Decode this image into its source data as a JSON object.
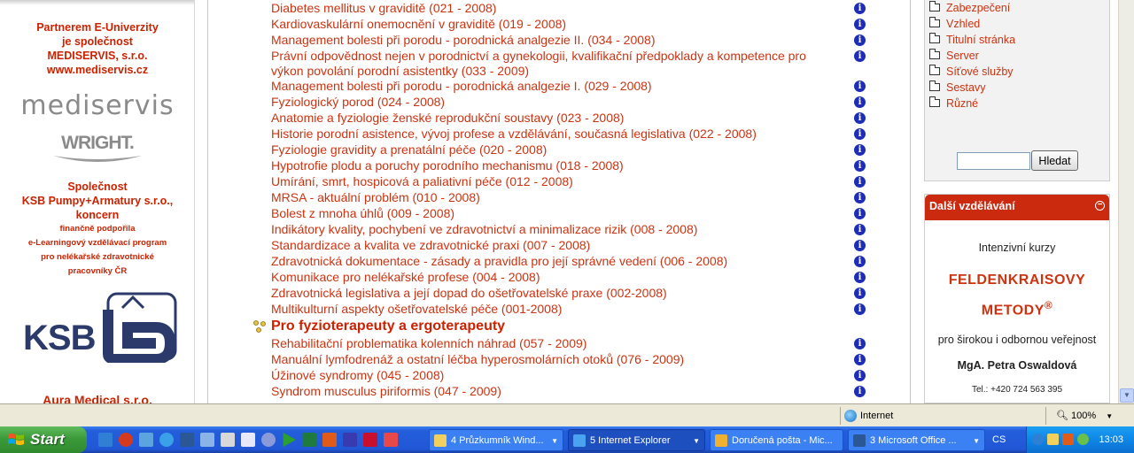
{
  "left_panel": {
    "partner_lines": [
      "Partnerem E-Univerzity",
      "je společnost",
      "MEDISERVIS, s.r.o.",
      "www.mediservis.cz"
    ],
    "mediservis_logo": "mediservis",
    "wright_logo": "WRIGHT.",
    "company_lines": [
      "Společnost",
      "KSB Pumpy+Armatury s.r.o.,",
      "koncern"
    ],
    "support_lines": [
      "finančně podpořila",
      "e-Learningový vzdělávací program",
      "pro nelékařské zdravotnické",
      "pracovníky ČR"
    ],
    "ksb_logo": "KSB",
    "aura": "Aura Medical s.r.o."
  },
  "courses_top": [
    "Diabetes mellitus v graviditě (021 - 2008)",
    "Kardiovaskulární onemocnění v graviditě (019 - 2008)",
    "Management bolesti při porodu - porodnická analgezie II. (034 - 2008)",
    "Právní odpovědnost nejen v porodnictví a gynekologii, kvalifikační předpoklady a kompetence pro výkon povolání porodní asistentky (033 - 2009)",
    "Management bolesti při porodu - porodnická analgezie I. (029 - 2008)",
    "Fyziologický porod (024 - 2008)",
    "Anatomie a fyziologie ženské reprodukční soustavy (023 - 2008)",
    "Historie porodní asistence, vývoj profese a vzdělávání, současná legislativa (022 - 2008)",
    "Fyziologie gravidity a prenatální péče (020 - 2008)",
    "Hypotrofie plodu a poruchy porodního mechanismu (018 - 2008)",
    "Umírání, smrt, hospicová a paliativní péče (012 - 2008)",
    "MRSA - aktuální problém (010 - 2008)",
    "Bolest z mnoha úhlů (009 - 2008)",
    "Indikátory kvality, pochybení ve zdravotnictví a minimalizace rizik (008 - 2008)",
    "Standardizace a kvalita ve zdravotnické praxi (007 - 2008)",
    "Zdravotnická dokumentace - zásady a pravidla pro její správné vedení (006 - 2008)",
    "Komunikace pro nelékařské profese (004 - 2008)",
    "Zdravotnická legislativa a její dopad do ošetřovatelské praxe (002-2008)",
    "Multikulturní aspekty ošetřovatelské péče (001-2008)"
  ],
  "category_heading": "Pro fyzioterapeuty a ergoterapeuty",
  "courses_bottom": [
    "Rehabilitační problematika kolenních náhrad (057 - 2009)",
    "Manuální lymfodrenáž a ostatní léčba hyperosmolárních otoků (076 - 2009)",
    "Úžinové syndromy (045 - 2008)",
    "Syndrom musculus piriformis (047 - 2009)"
  ],
  "info_icon": "i",
  "right_panel": {
    "categories": [
      "Zabezpečení",
      "Vzhled",
      "Titulní stránka",
      "Server",
      "Síťové služby",
      "Sestavy",
      "Různé"
    ],
    "search_button": "Hledat",
    "search_value": "",
    "edu_title": "Další vzdělávání",
    "edu_collapse": "−",
    "edu_intro": "Intenzivní kurzy",
    "edu_feld_1": "FELDENKRAISOVY",
    "edu_feld_2": "METODY",
    "edu_reg": "®",
    "edu_audience": "pro širokou i odbornou veřejnost",
    "edu_person": "MgA. Petra Oswaldová",
    "edu_phone": "Tel.: +420 724 563 395"
  },
  "statusbar": {
    "zone": "Internet",
    "zoom": "100%"
  },
  "taskbar": {
    "start": "Start",
    "buttons": [
      {
        "label": "4 Průzkumník Wind...",
        "active": false
      },
      {
        "label": "5 Internet Explorer",
        "active": true
      },
      {
        "label": "Doručená pošta - Mic...",
        "active": false
      },
      {
        "label": "3 Microsoft Office ...",
        "active": false
      }
    ],
    "lang": "CS",
    "clock": "13:03"
  },
  "colors": {
    "link": "#cc3311",
    "accent": "#cc2a0e",
    "info_icon": "#1d2db5",
    "taskbar": "#245edb"
  }
}
